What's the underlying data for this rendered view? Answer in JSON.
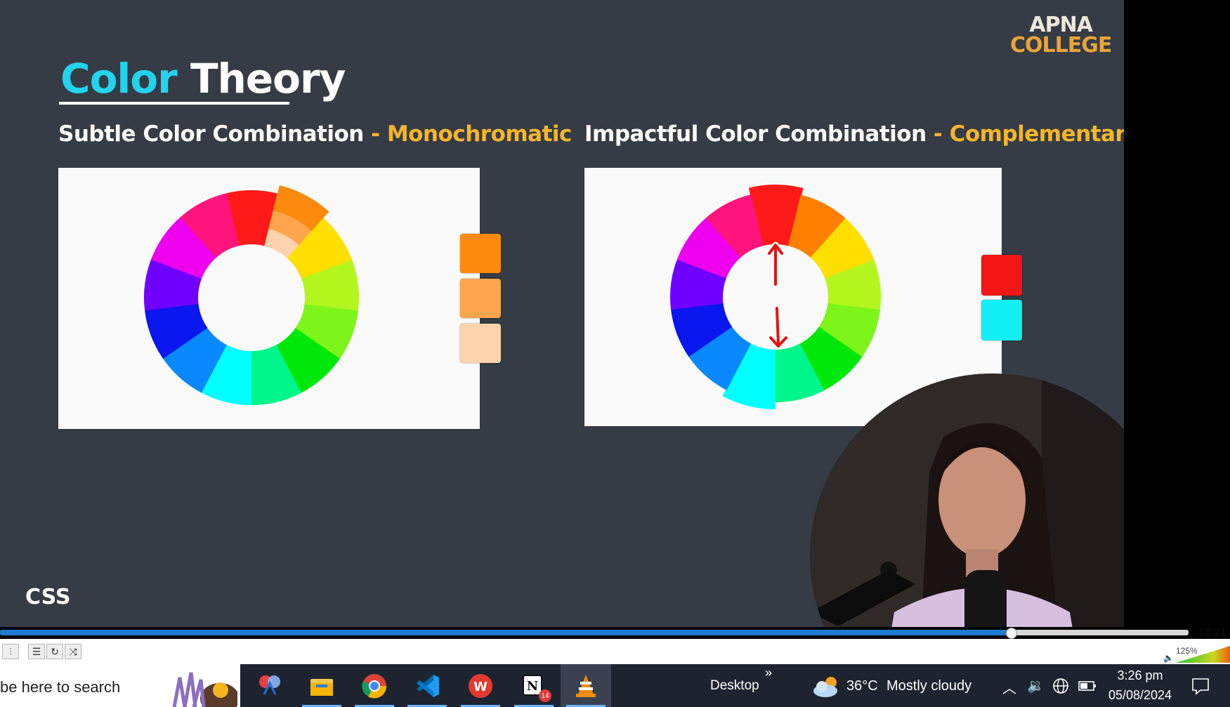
{
  "slide": {
    "title_word1": "Color",
    "title_word2": "Theory",
    "left_heading": "Subtle Color Combination",
    "left_accent": "Monochromatic",
    "right_heading": "Impactful Color Combination",
    "right_accent": "Complementary",
    "dash": " - ",
    "logo_line1": "APNA",
    "logo_line2": "COLLEGE",
    "corner_tag": "CSS",
    "mono_swatches": [
      "#fb8a0e",
      "#fda54d",
      "#fdd3ad"
    ],
    "comp_swatches": [
      "#f41616",
      "#12f0f4"
    ],
    "wheel_colors": [
      "#ff1a1a",
      "#ff8000",
      "#ffdf00",
      "#b4f51d",
      "#7df51a",
      "#00e80a",
      "#00f58a",
      "#00ffff",
      "#0a88ff",
      "#0a17f0",
      "#7000ff",
      "#ee00ee",
      "#ff147d"
    ]
  },
  "player": {
    "time": "12:21",
    "volume": "125%",
    "progress": 0.851,
    "buttons": [
      "equalizer-button",
      "playlist-button",
      "loop-button",
      "shuffle-button"
    ]
  },
  "taskbar": {
    "search_placeholder": "be here to search",
    "apps": [
      "snipping-tool",
      "file-explorer",
      "chrome",
      "vscode",
      "wps-office",
      "notion",
      "vlc"
    ],
    "notion_badge": "14",
    "desktop_label": "Desktop",
    "chevrons": "»",
    "weather_temp": "36°C",
    "weather_desc": "Mostly cloudy",
    "clock_time": "3:26 pm",
    "clock_date": "05/08/2024"
  }
}
